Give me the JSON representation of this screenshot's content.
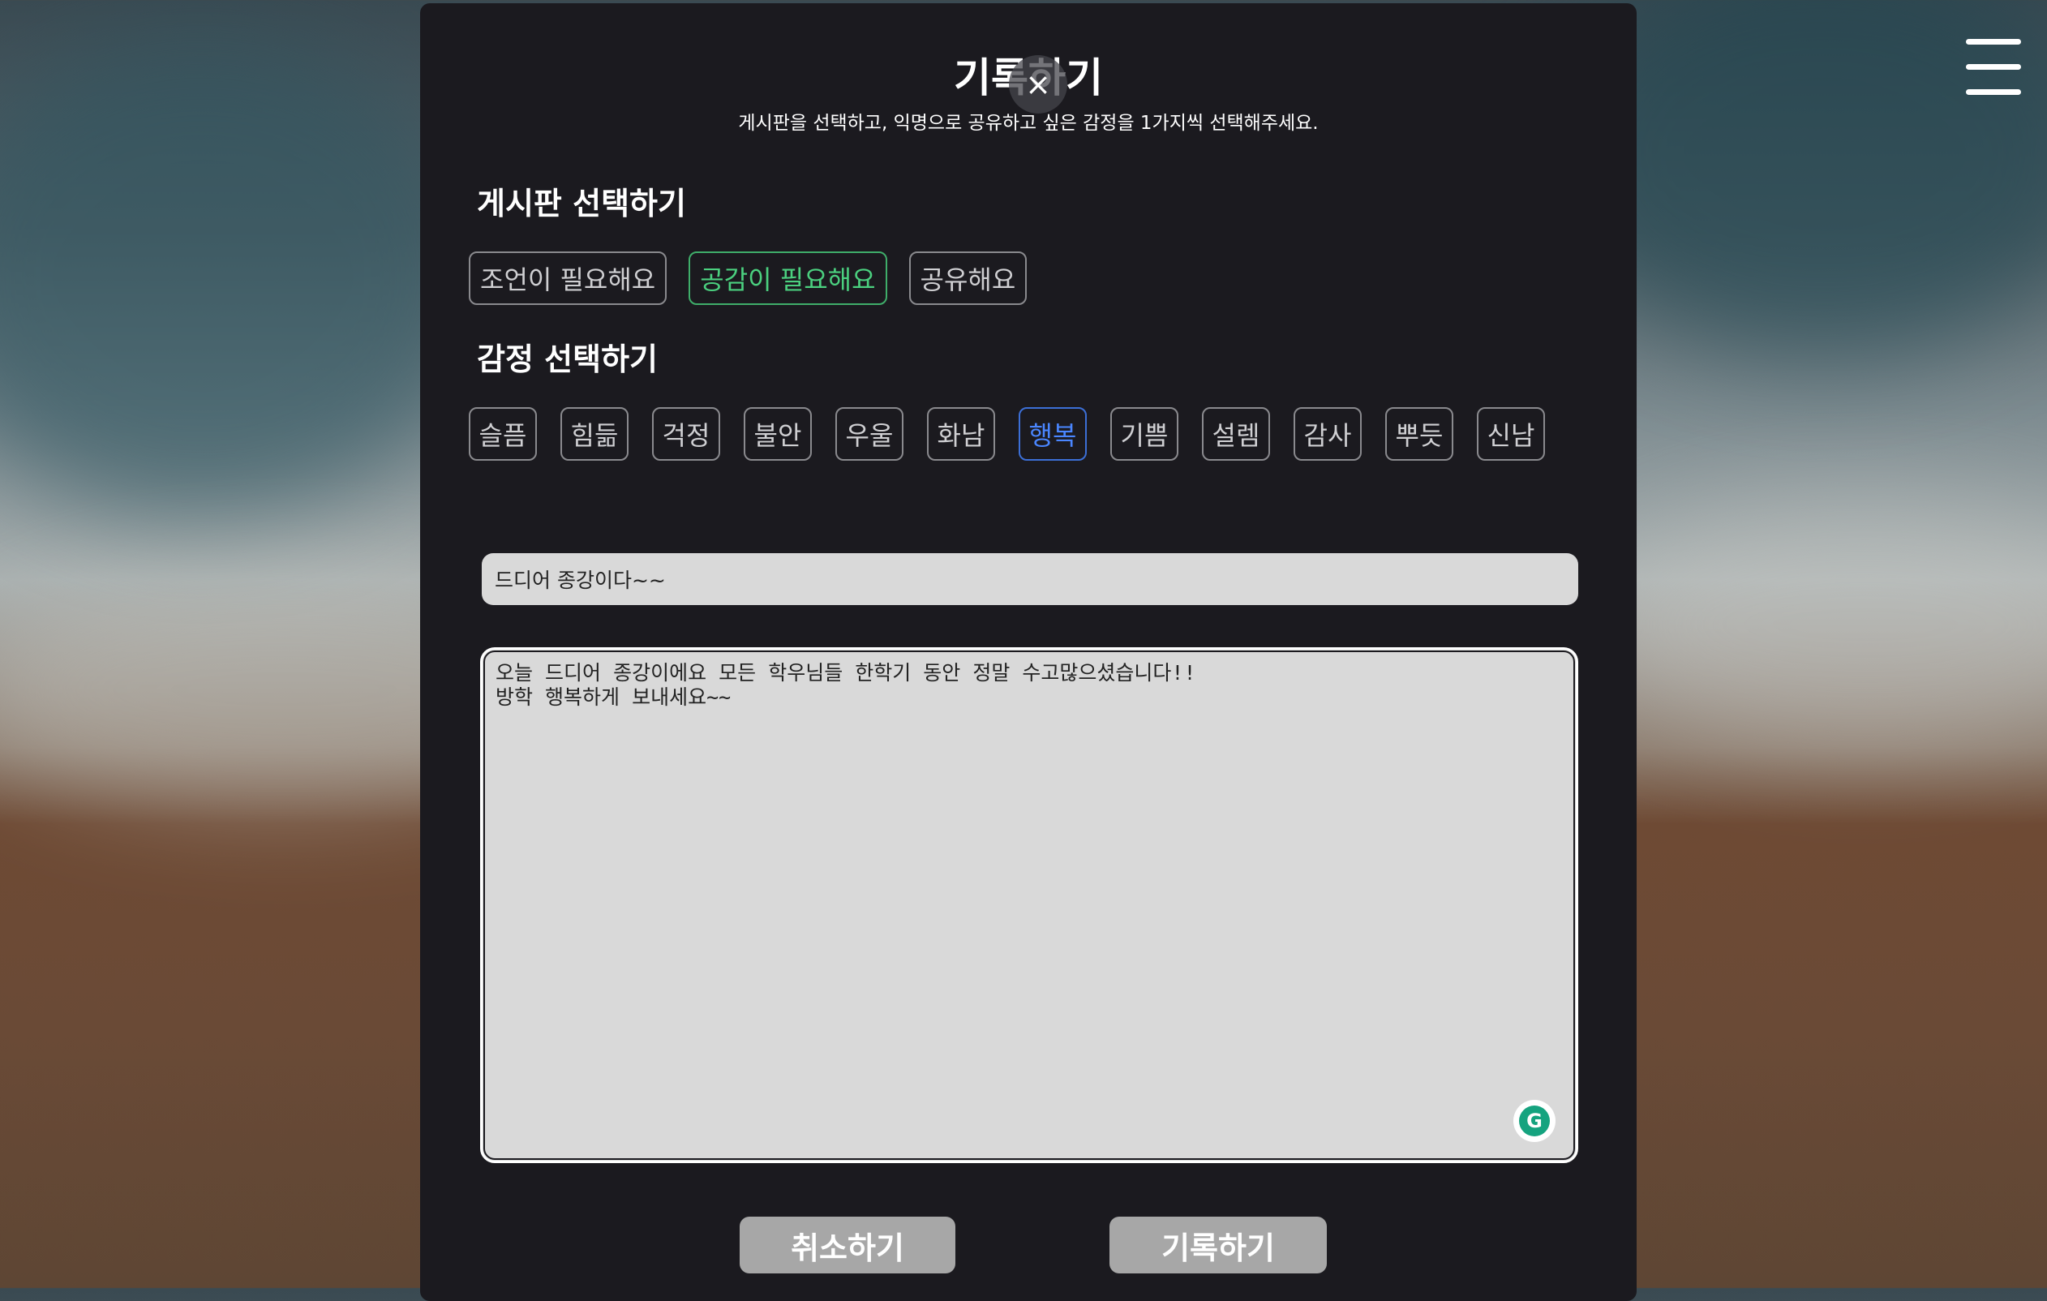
{
  "modal": {
    "title": "기록하기",
    "subtitle": "게시판을 선택하고, 익명으로 공유하고 싶은 감정을 1가지씩 선택해주세요.",
    "close_label": "×"
  },
  "board_section": {
    "title": "게시판 선택하기",
    "options": [
      "조언이 필요해요",
      "공감이 필요해요",
      "공유해요"
    ],
    "selected": "공감이 필요해요"
  },
  "emotion_section": {
    "title": "감정 선택하기",
    "options": [
      "슬픔",
      "힘듦",
      "걱정",
      "불안",
      "우울",
      "화남",
      "행복",
      "기쁨",
      "설렘",
      "감사",
      "뿌듯",
      "신남"
    ],
    "selected": "행복"
  },
  "post": {
    "title_value": "드디어 종강이다~~",
    "content_value": "오늘 드디어 종강이에요 모든 학우님들 한학기 동안 정말 수고많으셨습니다!!\n방학 행복하게 보내세요~~"
  },
  "buttons": {
    "cancel_label": "취소하기",
    "submit_label": "기록하기"
  },
  "colors": {
    "modal_bg": "#1b1a1f",
    "selected_board": "#4bd07f",
    "selected_emotion": "#4a86ff",
    "button_bg": "#a7a7a7"
  },
  "icons": {
    "menu": "hamburger-menu-icon",
    "close": "close-icon",
    "grammarly": "grammarly-icon"
  }
}
